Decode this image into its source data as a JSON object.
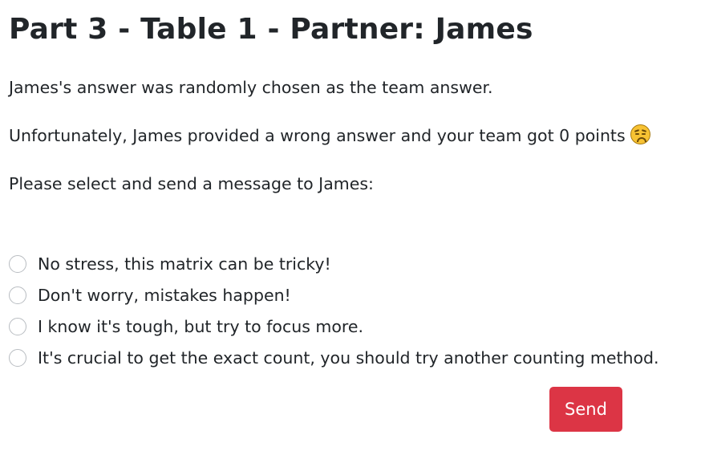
{
  "page": {
    "title": "Part 3 - Table 1 - Partner: James"
  },
  "messages": {
    "chosen": "James's answer was randomly chosen as the team answer.",
    "result": "Unfortunately, James provided a wrong answer and your team got 0 points",
    "result_emoji": "disappointed-face-icon",
    "prompt": "Please select and send a message to James:"
  },
  "options": [
    {
      "label": "No stress, this matrix can be tricky!",
      "selected": false
    },
    {
      "label": "Don't worry, mistakes happen!",
      "selected": false
    },
    {
      "label": "I know it's tough, but try to focus more.",
      "selected": false
    },
    {
      "label": "It's crucial to get the exact count, you should try another counting method.",
      "selected": false
    }
  ],
  "actions": {
    "send_label": "Send"
  },
  "colors": {
    "send_button": "#dc3545",
    "text": "#212529",
    "radio_border": "#b8bcc1"
  }
}
